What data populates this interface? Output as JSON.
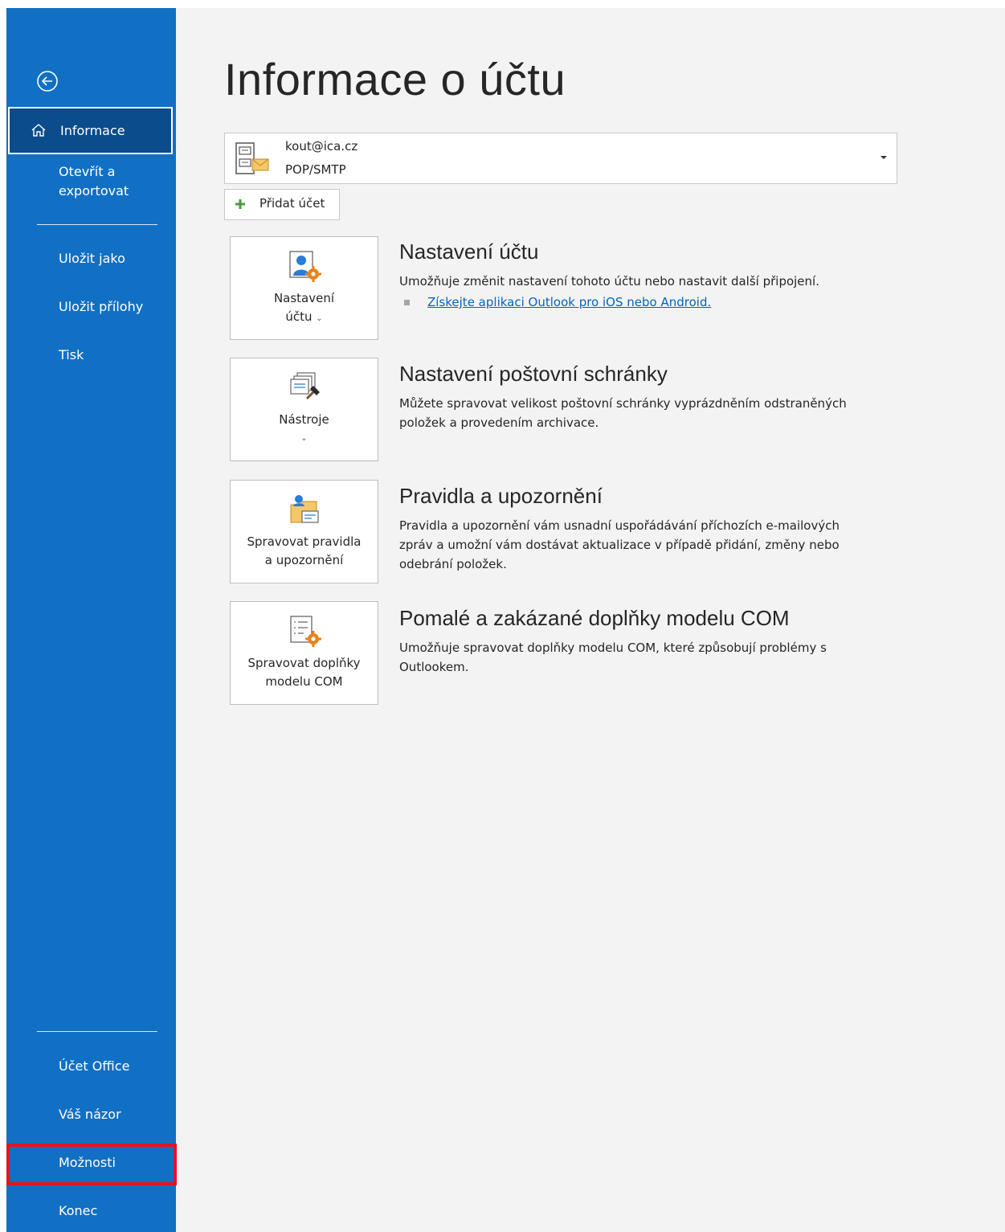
{
  "sidebar": {
    "back_label": "",
    "selected": "Informace",
    "items_top": [
      "Otevřít a",
      "exportovat"
    ],
    "save_as": "Uložit jako",
    "save_attachments": "Uložit přílohy",
    "print": "Tisk",
    "office_account": "Účet Office",
    "feedback": "Váš názor",
    "options": "Možnosti",
    "exit": "Konec"
  },
  "main": {
    "title": "Informace o účtu",
    "account": {
      "email": "kout@ica.cz",
      "type": "POP/SMTP"
    },
    "add_account": "Přidat účet",
    "sections": [
      {
        "tile_line1": "Nastavení",
        "tile_line2": "účtu",
        "title": "Nastavení účtu",
        "description": "Umožňuje změnit nastavení tohoto účtu nebo nastavit další připojení.",
        "link": "Získejte aplikaci Outlook pro iOS nebo Android."
      },
      {
        "tile_line1": "Nástroje",
        "title": "Nastavení poštovní schránky",
        "description_1": "Můžete spravovat velikost poštovní schránky vyprázdněním odstraněných",
        "description_2": "položek a provedením archivace."
      },
      {
        "tile_line1": "Spravovat pravidla",
        "tile_line2": "a upozornění",
        "title": "Pravidla a upozornění",
        "description_1": "Pravidla a upozornění vám usnadní uspořádávání příchozích e-mailových",
        "description_2": "zpráv a umožní vám dostávat aktualizace v případě přidání, změny nebo",
        "description_3": "odebrání položek."
      },
      {
        "tile_line1": "Spravovat doplňky",
        "tile_line2": "modelu COM",
        "title": "Pomalé a zakázané doplňky modelu COM",
        "description_1": "Umožňuje spravovat doplňky modelu COM, které způsobují problémy s",
        "description_2": "Outlookem."
      }
    ]
  },
  "colors": {
    "sidebar_bg": "#1170c4",
    "sidebar_selected": "#0b4c8c",
    "highlight": "#e81123",
    "link": "#0563c1",
    "accent_orange": "#e8821c"
  }
}
